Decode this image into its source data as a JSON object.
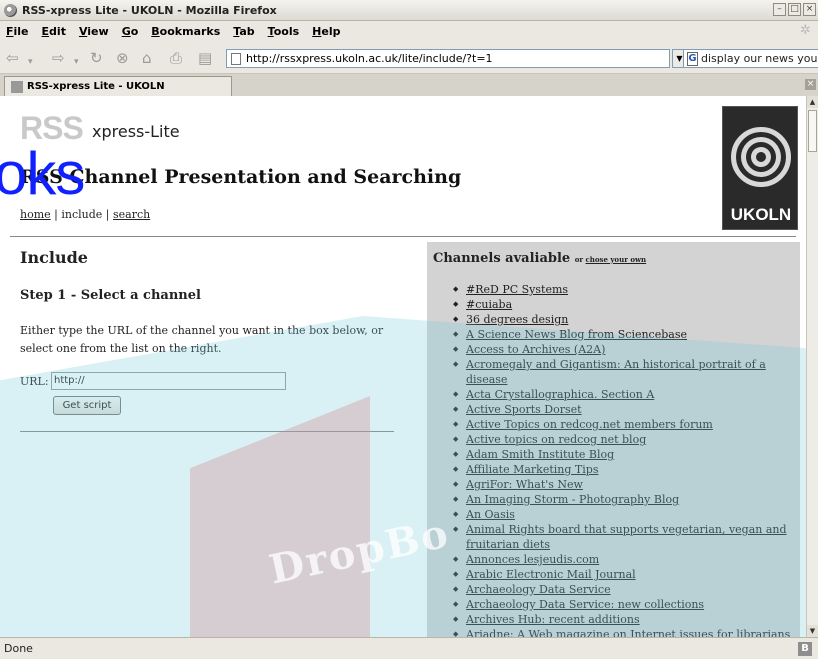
{
  "window": {
    "title": "RSS-xpress Lite - UKOLN - Mozilla Firefox"
  },
  "menu": [
    "File",
    "Edit",
    "View",
    "Go",
    "Bookmarks",
    "Tab",
    "Tools",
    "Help"
  ],
  "navbar": {
    "url": "http://rssxpress.ukoln.ac.uk/lite/include/?t=1",
    "search_text": "display our news your"
  },
  "tab": {
    "label": "RSS-xpress Lite - UKOLN"
  },
  "overlay_text": "oks",
  "watermark_text": "DropBo",
  "page": {
    "logo_rss": "RSS",
    "logo_xpress": "xpress-Lite",
    "heading": "RSS Channel Presentation and Searching",
    "nav": {
      "home": "home",
      "sep1": " | ",
      "include": "include",
      "sep2": " | ",
      "search": "search"
    },
    "ukoln_logo": "UKOLN",
    "include_heading": "Include",
    "step_heading": "Step 1 - Select a channel",
    "instructions": "Either type the URL of the channel you want in the box below, or select one from the list on the right.",
    "url_label": "URL:",
    "url_value": "http://",
    "get_script": "Get script",
    "channels_heading": "Channels avaliable",
    "channels_or": "or",
    "channels_choose": "chose your own",
    "channels": [
      "#ReD PC Systems",
      "#cuiaba",
      "36 degrees design",
      "A Science News Blog from Sciencebase",
      "Access to Archives (A2A)",
      "Acromegaly and Gigantism: An historical portrait of a disease",
      "Acta Crystallographica. Section A",
      "Active Sports Dorset",
      "Active Topics on redcog.net members forum",
      "Active topics on redcog net blog",
      "Adam Smith Institute Blog",
      "Affiliate Marketing Tips",
      "AgriFor: What's New",
      "An Imaging Storm - Photography Blog",
      "An Oasis",
      "Animal Rights board that supports vegetarian, vegan and fruitarian diets",
      "Annonces lesjeudis.com",
      "Arabic Electronic Mail Journal",
      "Archaeology Data Service",
      "Archaeology Data Service: new collections",
      "Archives Hub: recent additions",
      "Ariadne: A Web magazine on Internet issues for librarians and"
    ]
  },
  "status": {
    "text": "Done",
    "icon_letter": "B"
  },
  "colors": {
    "overlay": "#1020ff",
    "watermark": "#78c8d7",
    "chrome": "#eae8e0"
  }
}
